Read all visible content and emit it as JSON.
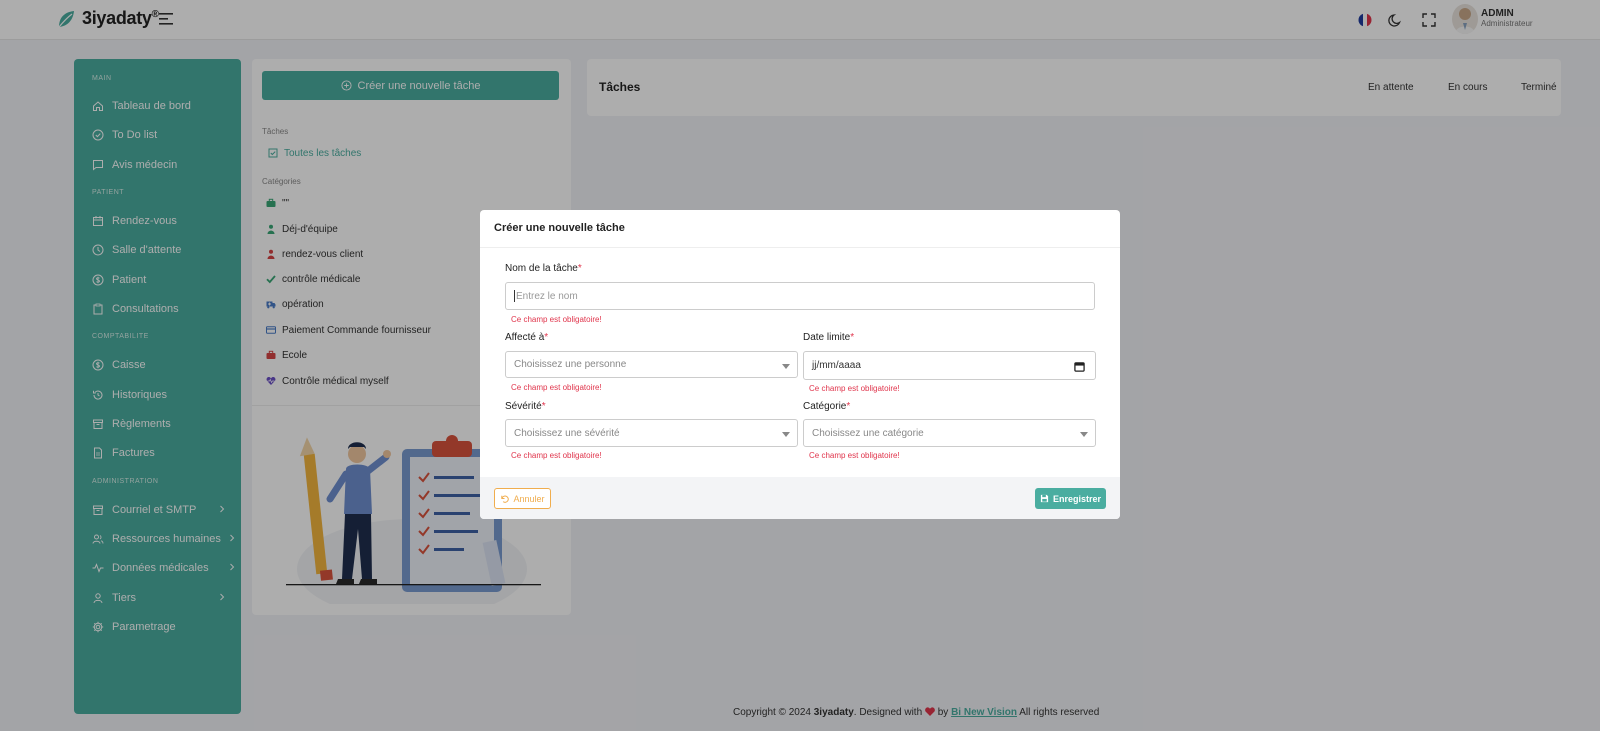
{
  "app": {
    "logo_text": "3iyadaty",
    "logo_mark": "®",
    "user_name": "ADMIN",
    "user_role": "Administrateur"
  },
  "sidebar": {
    "sections": [
      "MAIN",
      "PATIENT",
      "COMPTABILITE",
      "ADMINISTRATION"
    ],
    "items": [
      {
        "label": "Tableau de bord",
        "icon": "home-icon"
      },
      {
        "label": "To Do list",
        "icon": "check-circle-icon"
      },
      {
        "label": "Avis médecin",
        "icon": "message-icon"
      },
      {
        "label": "Rendez-vous",
        "icon": "calendar-icon"
      },
      {
        "label": "Salle d'attente",
        "icon": "clock-icon"
      },
      {
        "label": "Patient",
        "icon": "dollar-circle-icon"
      },
      {
        "label": "Consultations",
        "icon": "clipboard-icon"
      },
      {
        "label": "Caisse",
        "icon": "dollar-circle-icon"
      },
      {
        "label": "Historiques",
        "icon": "history-icon"
      },
      {
        "label": "Règlements",
        "icon": "archive-icon"
      },
      {
        "label": "Factures",
        "icon": "file-icon"
      },
      {
        "label": "Courriel et SMTP",
        "icon": "archive-icon"
      },
      {
        "label": "Ressources humaines",
        "icon": "users-icon"
      },
      {
        "label": "Données médicales",
        "icon": "activity-icon"
      },
      {
        "label": "Tiers",
        "icon": "user-icon"
      },
      {
        "label": "Parametrage",
        "icon": "settings-icon"
      }
    ]
  },
  "tasks_panel": {
    "create_label": "Créer une nouvelle tâche",
    "tasks_section": "Tâches",
    "all_tasks": "Toutes les tâches",
    "categories_section": "Catégories",
    "categories": [
      {
        "label": "\"\"",
        "color": "#3aa776"
      },
      {
        "label": "Déj-d'équipe",
        "color": "#3aa776"
      },
      {
        "label": "rendez-vous client",
        "color": "#d64545"
      },
      {
        "label": "contrôle médicale",
        "color": "#3aa776"
      },
      {
        "label": "opération",
        "color": "#4a7cc7"
      },
      {
        "label": "Paiement Commande fournisseur",
        "color": "#4a7cc7"
      },
      {
        "label": "Ecole",
        "color": "#d64545"
      },
      {
        "label": "Contrôle médical myself",
        "color": "#6a4fc7"
      }
    ]
  },
  "main": {
    "title": "Tâches",
    "tabs": [
      "En attente",
      "En cours",
      "Terminé"
    ]
  },
  "footer": {
    "prefix": "Copyright © 2024",
    "brand": "3iyadaty",
    "designed": ". Designed with",
    "by": "by",
    "company": "Bi New Vision",
    "suffix": "All rights reserved"
  },
  "modal": {
    "title": "Créer une nouvelle tâche",
    "name_label": "Nom de la tâche",
    "name_placeholder": "Entrez le nom",
    "assigned_label": "Affecté à",
    "assigned_placeholder": "Choisissez une personne",
    "due_label": "Date limite",
    "due_placeholder": "jj/mm/aaaa",
    "severity_label": "Sévérité",
    "severity_placeholder": "Choisissez une sévérité",
    "category_label": "Catégorie",
    "category_placeholder": "Choisissez une catégorie",
    "required_mark": "*",
    "error_text": "Ce champ est obligatoire!",
    "cancel_label": "Annuler",
    "save_label": "Enregistrer"
  },
  "colors": {
    "accent": "#4aada0",
    "error": "#e0354c",
    "warning": "#f0ad4e"
  }
}
